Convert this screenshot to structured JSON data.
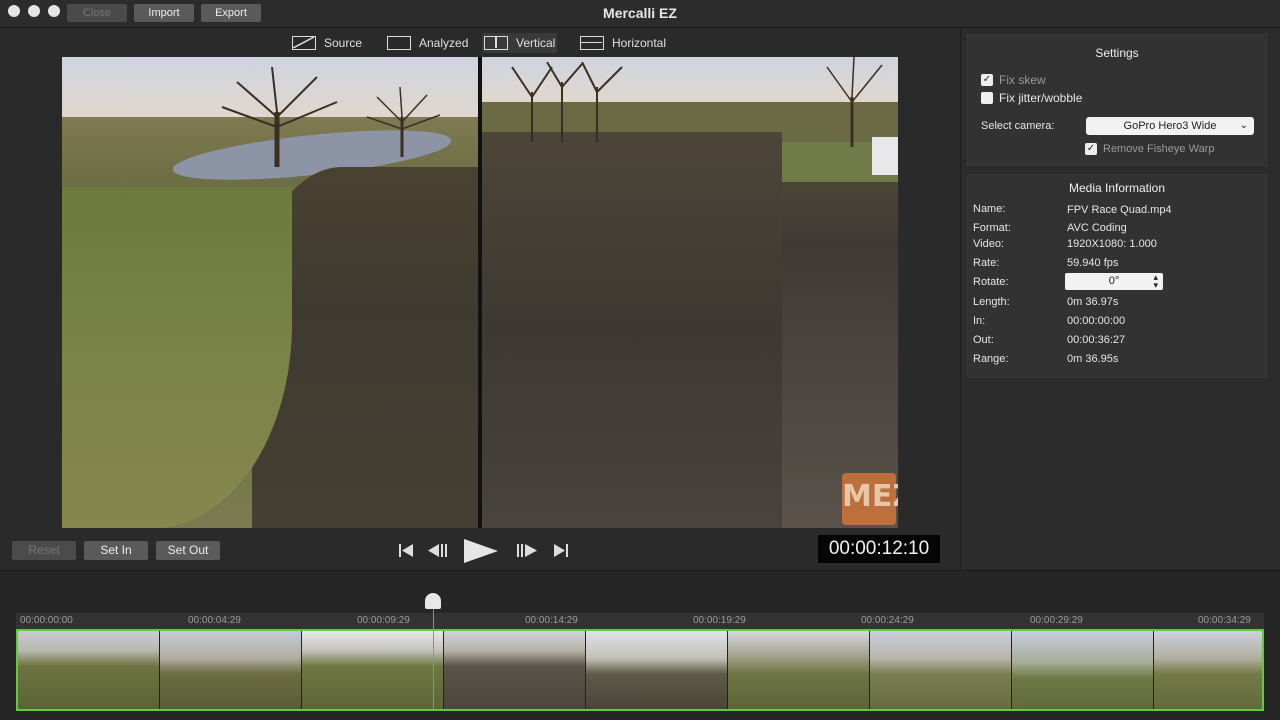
{
  "app": {
    "title": "Mercalli EZ",
    "buttons": {
      "close": "Close",
      "import": "Import",
      "export": "Export"
    }
  },
  "view_modes": [
    {
      "label": "Source",
      "icon": "source-view-icon",
      "active": false
    },
    {
      "label": "Analyzed",
      "icon": "analyzed-view-icon",
      "active": false
    },
    {
      "label": "Vertical",
      "icon": "vertical-split-icon",
      "active": true
    },
    {
      "label": "Horizontal",
      "icon": "horizontal-split-icon",
      "active": false
    }
  ],
  "watermark": "MEZ",
  "controls": {
    "reset": "Reset",
    "set_in": "Set In",
    "set_out": "Set Out",
    "timecode": "00:00:12:10"
  },
  "settings": {
    "title": "Settings",
    "fix_skew": {
      "label": "Fix skew",
      "checked": true
    },
    "fix_jitter": {
      "label": "Fix jitter/wobble",
      "checked": false
    },
    "camera_label": "Select camera:",
    "camera_value": "GoPro Hero3 Wide",
    "remove_fisheye": {
      "label": "Remove Fisheye Warp",
      "checked": true
    }
  },
  "media_info": {
    "title": "Media Information",
    "rows": [
      {
        "label": "Name:",
        "value": "FPV Race Quad.mp4"
      },
      {
        "label": "Format:",
        "value": "AVC Coding"
      },
      {
        "label": "Video:",
        "value": "1920X1080: 1.000"
      },
      {
        "label": "Rate:",
        "value": "59.940 fps"
      },
      {
        "label": "Rotate:",
        "value": "0°"
      },
      {
        "label": "Length:",
        "value": "0m 36.97s"
      },
      {
        "label": "In:",
        "value": "00:00:00:00"
      },
      {
        "label": "Out:",
        "value": "00:00:36:27"
      },
      {
        "label": "Range:",
        "value": "0m 36.95s"
      }
    ]
  },
  "timeline": {
    "tick_labels": [
      "00:00:00:00",
      "00:00:04:29",
      "00:00:09:29",
      "00:00:14:29",
      "00:00:19:29",
      "00:00:24:29",
      "00:00:29:29",
      "00:00:34:29"
    ],
    "playhead_position": "00:00:12:10",
    "thumbnail_count": 9
  },
  "colors": {
    "accent_green": "#5fcc3b",
    "playhead_blue": "#4aa3e8",
    "watermark_orange": "#c9733a"
  }
}
